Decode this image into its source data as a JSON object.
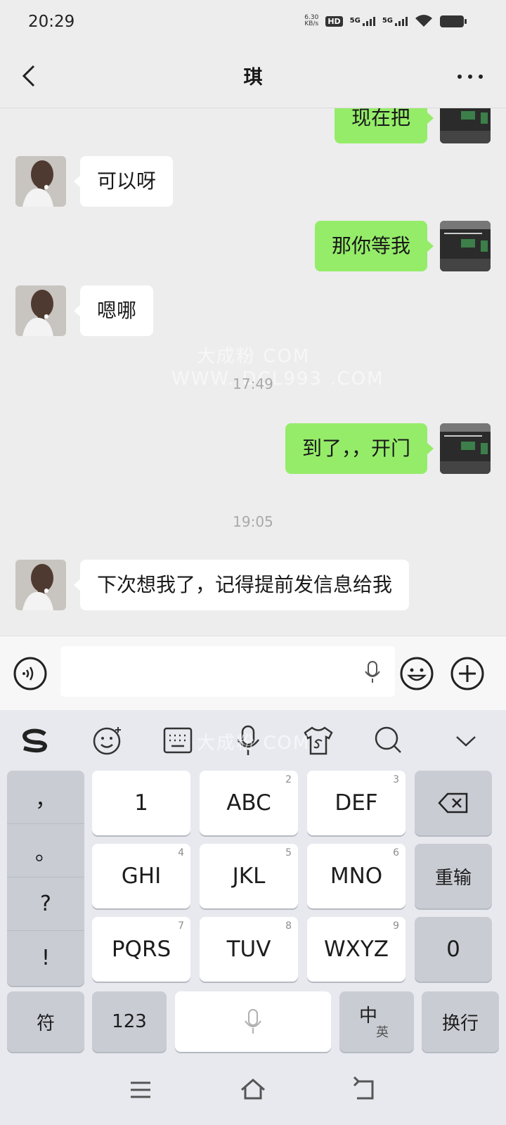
{
  "status_bar": {
    "time": "20:29",
    "net_speed_value": "6.30",
    "net_speed_unit": "KB/s",
    "hd_label": "HD",
    "signal1_label": "5G",
    "signal2_label": "5G"
  },
  "header": {
    "title": "琪"
  },
  "messages": [
    {
      "from": "me",
      "text": "现在把"
    },
    {
      "from": "her",
      "text": "可以呀"
    },
    {
      "from": "me",
      "text": "那你等我"
    },
    {
      "from": "her",
      "text": "嗯哪"
    },
    {
      "time": "17:49"
    },
    {
      "from": "me",
      "text": "到了，，开门"
    },
    {
      "time": "19:05"
    },
    {
      "from": "her",
      "text": "下次想我了，记得提前发信息给我"
    }
  ],
  "watermark": {
    "line1": "大成粉 COM",
    "line2": "WWW. DCL993 .COM"
  },
  "keyboard": {
    "punctuation": [
      "，",
      "。",
      "?",
      "!"
    ],
    "keys": [
      {
        "label": "1",
        "sub": ""
      },
      {
        "label": "ABC",
        "sub": "2"
      },
      {
        "label": "DEF",
        "sub": "3"
      },
      {
        "label": "GHI",
        "sub": "4"
      },
      {
        "label": "JKL",
        "sub": "5"
      },
      {
        "label": "MNO",
        "sub": "6"
      },
      {
        "label": "PQRS",
        "sub": "7"
      },
      {
        "label": "TUV",
        "sub": "8"
      },
      {
        "label": "WXYZ",
        "sub": "9"
      }
    ],
    "reinput": "重输",
    "zero": "0",
    "symbols": "符",
    "numbers": "123",
    "lang_main": "中",
    "lang_sub": "英",
    "enter": "换行"
  },
  "colors": {
    "my_bubble": "#95ec69",
    "her_bubble": "#ffffff",
    "chat_bg": "#ededed"
  }
}
